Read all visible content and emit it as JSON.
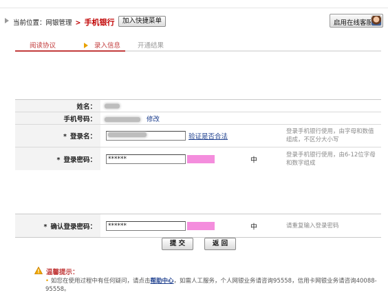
{
  "breadcrumb": {
    "prefix": "当前位置：网银管理",
    "sep": ">",
    "current": "手机银行",
    "quick_menu_label": "加入快捷菜单"
  },
  "online_service": {
    "label": "启用在线客服"
  },
  "steps": [
    {
      "label": "阅读协议",
      "state": "done"
    },
    {
      "label": "录入信息",
      "state": "active"
    },
    {
      "label": "开通结果",
      "state": "pending"
    }
  ],
  "form": {
    "name": {
      "label": "姓名："
    },
    "phone": {
      "label": "手机号码：",
      "modify_label": "修改"
    },
    "login_name": {
      "required_mark": "*",
      "label": "登录名：",
      "verify_link": "验证是否合法",
      "hint": "登录手机银行使用，由字母和数值组成，不区分大小写"
    },
    "login_password": {
      "required_mark": "*",
      "label": "登录密码：",
      "value": "******",
      "strength_char": "中",
      "hint": "登录手机银行使用，由6-12位字母和数字组成"
    },
    "confirm_password": {
      "required_mark": "*",
      "label": "确认登录密码：",
      "value": "******",
      "strength_char": "中",
      "hint": "请重复输入登录密码"
    }
  },
  "actions": {
    "submit": "提 交",
    "back": "返 回"
  },
  "tips": {
    "title": "温馨提示：",
    "bullet": "•",
    "text_1": "如您在使用过程中有任何疑问，请点击",
    "help_link": "帮助中心",
    "text_2": "，如需人工服务，个人网银业务请咨询95558，信用卡网银业务请咨询40088-95558。"
  },
  "colors": {
    "accent_red": "#c23b3b",
    "link_blue": "#1a3c8c",
    "strength_pink": "#f48ddd"
  }
}
